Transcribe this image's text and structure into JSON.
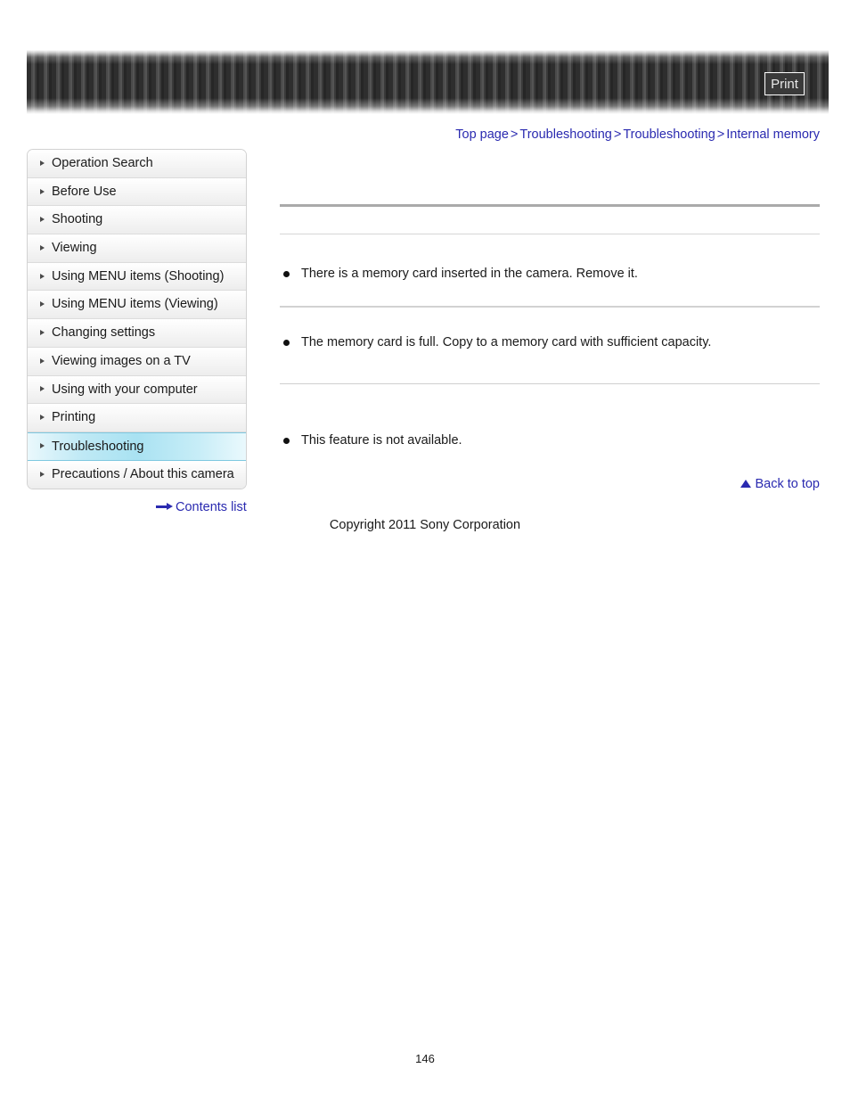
{
  "header": {
    "print_label": "Print"
  },
  "breadcrumb": {
    "separator": ">",
    "items": [
      {
        "label": "Top page"
      },
      {
        "label": "Troubleshooting"
      },
      {
        "label": "Troubleshooting"
      },
      {
        "label": "Internal memory"
      }
    ]
  },
  "sidebar": {
    "items": [
      {
        "label": "Operation Search",
        "active": false
      },
      {
        "label": "Before Use",
        "active": false
      },
      {
        "label": "Shooting",
        "active": false
      },
      {
        "label": "Viewing",
        "active": false
      },
      {
        "label": "Using MENU items (Shooting)",
        "active": false
      },
      {
        "label": "Using MENU items (Viewing)",
        "active": false
      },
      {
        "label": "Changing settings",
        "active": false
      },
      {
        "label": "Viewing images on a TV",
        "active": false
      },
      {
        "label": "Using with your computer",
        "active": false
      },
      {
        "label": "Printing",
        "active": false
      },
      {
        "label": "Troubleshooting",
        "active": true
      },
      {
        "label": "Precautions / About this camera",
        "active": false
      }
    ],
    "contents_list_label": "Contents list"
  },
  "main": {
    "section_title": "",
    "entries": [
      {
        "text": "There is a memory card inserted in the camera. Remove it."
      },
      {
        "text": "The memory card is full. Copy to a memory card with sufficient capacity."
      },
      {
        "text": "This feature is not available."
      }
    ]
  },
  "footer": {
    "back_to_top_label": "Back to top",
    "copyright": "Copyright 2011 Sony Corporation",
    "page_number": "146"
  },
  "colors": {
    "link": "#2a2ab0",
    "highlight": "#a9e2f2",
    "rule": "#aaaaaa"
  }
}
